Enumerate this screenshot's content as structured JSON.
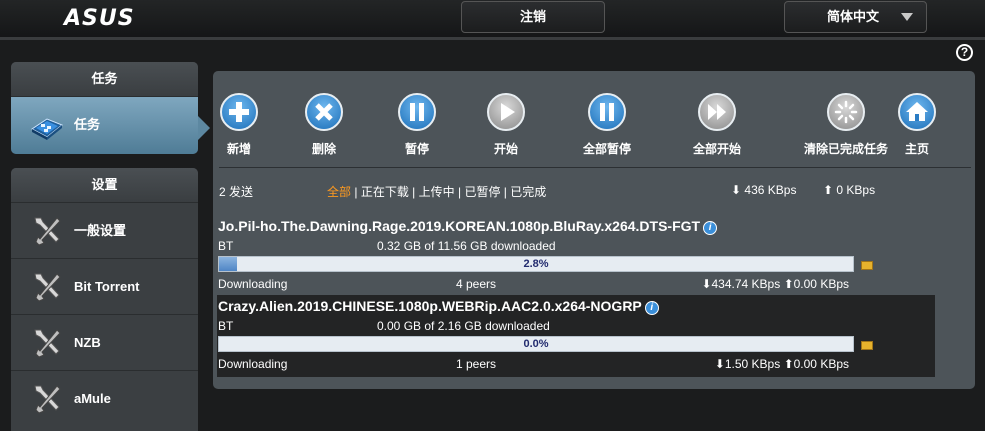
{
  "header": {
    "brand": "ASUS",
    "logout_label": "注销",
    "language": "简体中文",
    "help": "?"
  },
  "sidebar": {
    "tasks_section": {
      "title": "任务",
      "items": [
        {
          "label": "任务",
          "icon": "tasks-icon",
          "active": true
        }
      ]
    },
    "settings_section": {
      "title": "设置",
      "items": [
        {
          "label": "一般设置",
          "icon": "wrench-icon"
        },
        {
          "label": "Bit Torrent",
          "icon": "wrench-icon"
        },
        {
          "label": "NZB",
          "icon": "wrench-icon"
        },
        {
          "label": "aMule",
          "icon": "wrench-icon"
        }
      ]
    }
  },
  "toolbar": {
    "add": "新增",
    "delete": "删除",
    "pause": "暂停",
    "start": "开始",
    "pause_all": "全部暂停",
    "start_all": "全部开始",
    "clear_completed": "清除已完成任务",
    "home": "主页"
  },
  "status": {
    "count_text": "2 发送",
    "filters": [
      "全部",
      "正在下载",
      "上传中",
      "已暂停",
      "已完成"
    ],
    "separator": " | ",
    "active_filter": "全部",
    "download_speed": "436 KBps",
    "upload_speed": "0 KBps"
  },
  "tasks": [
    {
      "name": "Jo.Pil-ho.The.Dawning.Rage.2019.KOREAN.1080p.BluRay.x264.DTS-FGT",
      "type": "BT",
      "progress_text": "0.32 GB of 11.56 GB downloaded",
      "percent": "2.8%",
      "progress_fraction": 0.028,
      "state": "Downloading",
      "peers": "4 peers",
      "down": "434.74 KBps",
      "up": "0.00 KBps"
    },
    {
      "name": "Crazy.Alien.2019.CHINESE.1080p.WEBRip.AAC2.0.x264-NOGRP",
      "type": "BT",
      "progress_text": "0.00 GB of 2.16 GB downloaded",
      "percent": "0.0%",
      "progress_fraction": 0.0,
      "state": "Downloading",
      "peers": "1 peers",
      "down": "1.50 KBps",
      "up": "0.00 KBps"
    }
  ],
  "colors": {
    "accent_filter": "#ff9a1f",
    "button_blue": "#1c6fb8",
    "panel_bg": "#4d5459"
  }
}
